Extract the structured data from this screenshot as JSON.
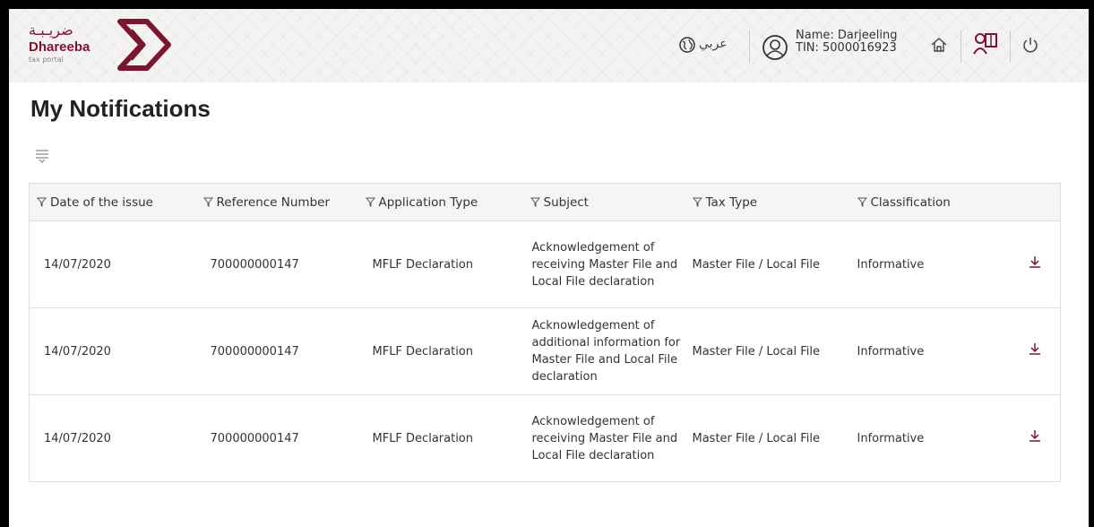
{
  "header": {
    "logo_ar": "ضريـبـة",
    "logo_en": "Dhareeba",
    "logo_sub": "tax portal",
    "language_label": "عربي",
    "user_name": "Name: Darjeeling",
    "user_tin": "TIN: 5000016923",
    "brand_color": "#7a1630"
  },
  "page": {
    "title": "My Notifications"
  },
  "table": {
    "columns": [
      "Date of the issue",
      "Reference Number",
      "Application Type",
      "Subject",
      "Tax Type",
      "Classification"
    ],
    "rows": [
      {
        "date": "14/07/2020",
        "reference": "700000000147",
        "application_type": "MFLF Declaration",
        "subject": "Acknowledgement of receiving Master File and Local File declaration",
        "tax_type": "Master File / Local File",
        "classification": "Informative"
      },
      {
        "date": "14/07/2020",
        "reference": "700000000147",
        "application_type": "MFLF Declaration",
        "subject": "Acknowledgement of additional information for Master File and Local File declaration",
        "tax_type": "Master File / Local File",
        "classification": "Informative"
      },
      {
        "date": "14/07/2020",
        "reference": "700000000147",
        "application_type": "MFLF Declaration",
        "subject": "Acknowledgement of receiving Master File and Local File declaration",
        "tax_type": "Master File / Local File",
        "classification": "Informative"
      }
    ]
  }
}
